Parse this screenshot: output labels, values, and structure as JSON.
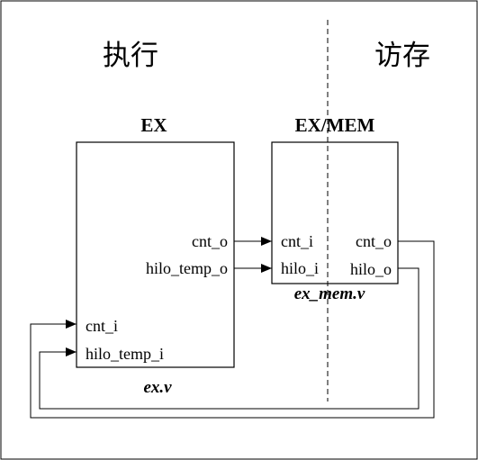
{
  "stages": {
    "execute": "执行",
    "memory_access": "访存"
  },
  "ex_module": {
    "title": "EX",
    "file": "ex.v",
    "outputs": [
      "cnt_o",
      "hilo_temp_o"
    ],
    "inputs": [
      "cnt_i",
      "hilo_temp_i"
    ]
  },
  "ex_mem_module": {
    "title": "EX/MEM",
    "file": "ex_mem.v",
    "inputs": [
      "cnt_i",
      "hilo_i"
    ],
    "outputs": [
      "cnt_o",
      "hilo_o"
    ]
  },
  "colors": {
    "line": "#000000",
    "background": "#ffffff",
    "divider": "#000000"
  }
}
